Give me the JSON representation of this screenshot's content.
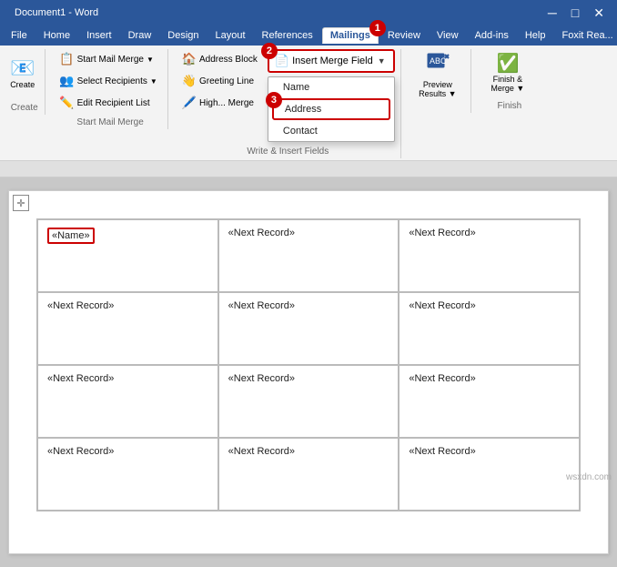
{
  "titleBar": {
    "appName": "Word",
    "docName": "Document1 - Word"
  },
  "menuBar": {
    "items": [
      {
        "id": "file",
        "label": "File"
      },
      {
        "id": "home",
        "label": "Home"
      },
      {
        "id": "insert",
        "label": "Insert"
      },
      {
        "id": "draw",
        "label": "Draw"
      },
      {
        "id": "design",
        "label": "Design"
      },
      {
        "id": "layout",
        "label": "Layout"
      },
      {
        "id": "references",
        "label": "References"
      },
      {
        "id": "mailings",
        "label": "Mailings",
        "active": true
      },
      {
        "id": "review",
        "label": "Review"
      },
      {
        "id": "view",
        "label": "View"
      },
      {
        "id": "addins",
        "label": "Add-ins"
      },
      {
        "id": "help",
        "label": "Help"
      },
      {
        "id": "foxit",
        "label": "Foxit Rea..."
      }
    ],
    "step1Label": "1"
  },
  "ribbon": {
    "groups": [
      {
        "id": "create",
        "label": "Create",
        "buttons": [
          {
            "id": "create-btn",
            "icon": "📧",
            "label": "Create"
          }
        ]
      },
      {
        "id": "start-mail-merge",
        "label": "Start Mail Merge",
        "rows": [
          {
            "id": "start-mail-merge-btn",
            "icon": "📋",
            "label": "Start Mail Merge",
            "hasArrow": true
          },
          {
            "id": "select-recipients-btn",
            "icon": "👥",
            "label": "Select Recipients",
            "hasArrow": true
          },
          {
            "id": "edit-recipient-list-btn",
            "icon": "✏️",
            "label": "Edit Recipient List"
          }
        ]
      },
      {
        "id": "write-insert",
        "label": "Write & Insert Fields",
        "showMergeField": true,
        "rows": [
          {
            "id": "address-block-btn",
            "icon": "🏠",
            "label": "Address Block"
          },
          {
            "id": "greeting-line-btn",
            "icon": "👋",
            "label": "Greeting Line"
          },
          {
            "id": "highlight-merge-btn",
            "icon": "🖊️",
            "label": "Highlight Merge Fields"
          }
        ],
        "insertMergeField": {
          "label": "Insert Merge Field",
          "stepNum": "2"
        },
        "dropdown": {
          "items": [
            {
              "id": "name-item",
              "label": "Name",
              "selected": false
            },
            {
              "id": "address-item",
              "label": "Address",
              "selected": true,
              "stepNum": "3"
            },
            {
              "id": "contact-item",
              "label": "Contact",
              "selected": false
            }
          ]
        }
      },
      {
        "id": "preview",
        "label": "Preview Results",
        "buttons": [
          {
            "id": "preview-results-btn",
            "icon": "👁️",
            "label": "Preview Results",
            "hasArrow": true
          }
        ]
      },
      {
        "id": "finish",
        "label": "Finish",
        "buttons": [
          {
            "id": "finish-merge-btn",
            "icon": "✅",
            "label": "Finish & Merge",
            "hasArrow": true
          }
        ]
      }
    ]
  },
  "document": {
    "labelGrid": {
      "cells": [
        [
          {
            "id": "cell-1-1",
            "content": "«Name»",
            "highlighted": true
          },
          {
            "id": "cell-1-2",
            "content": "«Next Record»",
            "highlighted": false
          },
          {
            "id": "cell-1-3",
            "content": "«Next Record»",
            "highlighted": false
          }
        ],
        [
          {
            "id": "cell-2-1",
            "content": "«Next Record»",
            "highlighted": false
          },
          {
            "id": "cell-2-2",
            "content": "«Next Record»",
            "highlighted": false
          },
          {
            "id": "cell-2-3",
            "content": "«Next Record»",
            "highlighted": false
          }
        ],
        [
          {
            "id": "cell-3-1",
            "content": "«Next Record»",
            "highlighted": false
          },
          {
            "id": "cell-3-2",
            "content": "«Next Record»",
            "highlighted": false
          },
          {
            "id": "cell-3-3",
            "content": "«Next Record»",
            "highlighted": false
          }
        ],
        [
          {
            "id": "cell-4-1",
            "content": "«Next Record»",
            "highlighted": false
          },
          {
            "id": "cell-4-2",
            "content": "«Next Record»",
            "highlighted": false
          },
          {
            "id": "cell-4-3",
            "content": "«Next Record»",
            "highlighted": false
          }
        ]
      ]
    }
  },
  "watermark": {
    "text": "wsxdn.com"
  }
}
